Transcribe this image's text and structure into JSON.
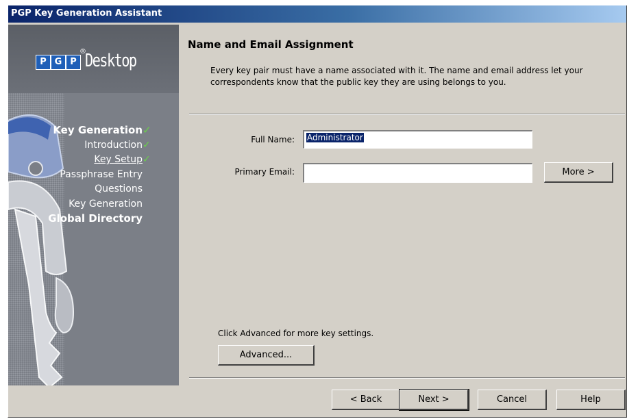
{
  "window": {
    "title": "PGP Key Generation Assistant"
  },
  "sidebar": {
    "logo": {
      "letters": [
        "P",
        "G",
        "P"
      ],
      "registered": "®",
      "product": "Desktop"
    },
    "steps": [
      {
        "label": "Key Generation",
        "done": true,
        "style": "heading"
      },
      {
        "label": "Introduction",
        "done": true,
        "style": "normal"
      },
      {
        "label": "Key Setup",
        "done": true,
        "style": "current"
      },
      {
        "label": "Passphrase Entry",
        "done": false,
        "style": "normal"
      },
      {
        "label": "Questions",
        "done": false,
        "style": "normal"
      },
      {
        "label": "Key Generation",
        "done": false,
        "style": "normal"
      },
      {
        "label": "Global Directory",
        "done": false,
        "style": "heading"
      }
    ],
    "check_glyph": "✓"
  },
  "main": {
    "heading": "Name and Email Assignment",
    "description": "Every key pair must have a name associated with it.  The name and email address let your correspondents know that the public key they are using belongs to you.",
    "form": {
      "full_name_label": "Full Name:",
      "full_name_value": "Administrator",
      "primary_email_label": "Primary Email:",
      "primary_email_value": "",
      "more_label": "More >"
    },
    "advanced_hint": "Click Advanced for more key settings.",
    "advanced_label": "Advanced..."
  },
  "footer": {
    "back_label": "< Back",
    "next_label": "Next >",
    "cancel_label": "Cancel",
    "help_label": "Help"
  },
  "colors": {
    "titlebar_start": "#0a246a",
    "sidebar": "#7b7f87",
    "dialog_bg": "#d4d0c8",
    "check": "#6bd14a",
    "pgp_blue": "#1f5fb8"
  }
}
